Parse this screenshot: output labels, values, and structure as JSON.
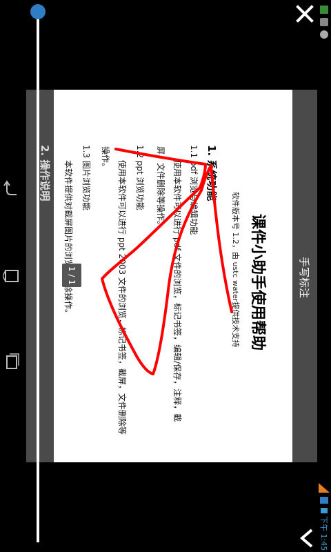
{
  "header": {
    "title": "手写标注"
  },
  "document": {
    "title": "课件小助手使用帮助",
    "version_line": "软件版本号 1.2，由 ustc water提供技术支持",
    "section1_heading": "1. 系统功能",
    "s11_heading": "1.1 pdf 浏览与编辑功能",
    "s11_body_1": "使用本软件可以进行 pdf 文件的浏览，标记书签，编辑/保存，注释，截",
    "s11_body_2": "屏，文件删除等操作。",
    "s12_heading": "1.2 ppt 浏览功能",
    "s12_body_1": "使用本软件可以进行 ppt 2003 文件的浏览，标记书签，截屏，文件删除等",
    "s12_body_2": "操作。",
    "s13_heading": "1.3 图片浏览功能",
    "s13_body": "本软件提供对截屏图片的浏览，删除操作。",
    "section2_heading": "2. 操作说明"
  },
  "page_indicator": "1 / 1",
  "status_bar": {
    "time": "下午 1:45"
  },
  "colors": {
    "ink": "#ff0000",
    "slider_knob": "#2f7dc2",
    "frame": "#4a4a4a"
  },
  "icons": {
    "close": "close-icon",
    "back": "back-icon",
    "home": "home-icon",
    "recent": "recent-apps-icon",
    "nav_back": "nav-back-icon"
  },
  "slider": {
    "value": 0
  }
}
